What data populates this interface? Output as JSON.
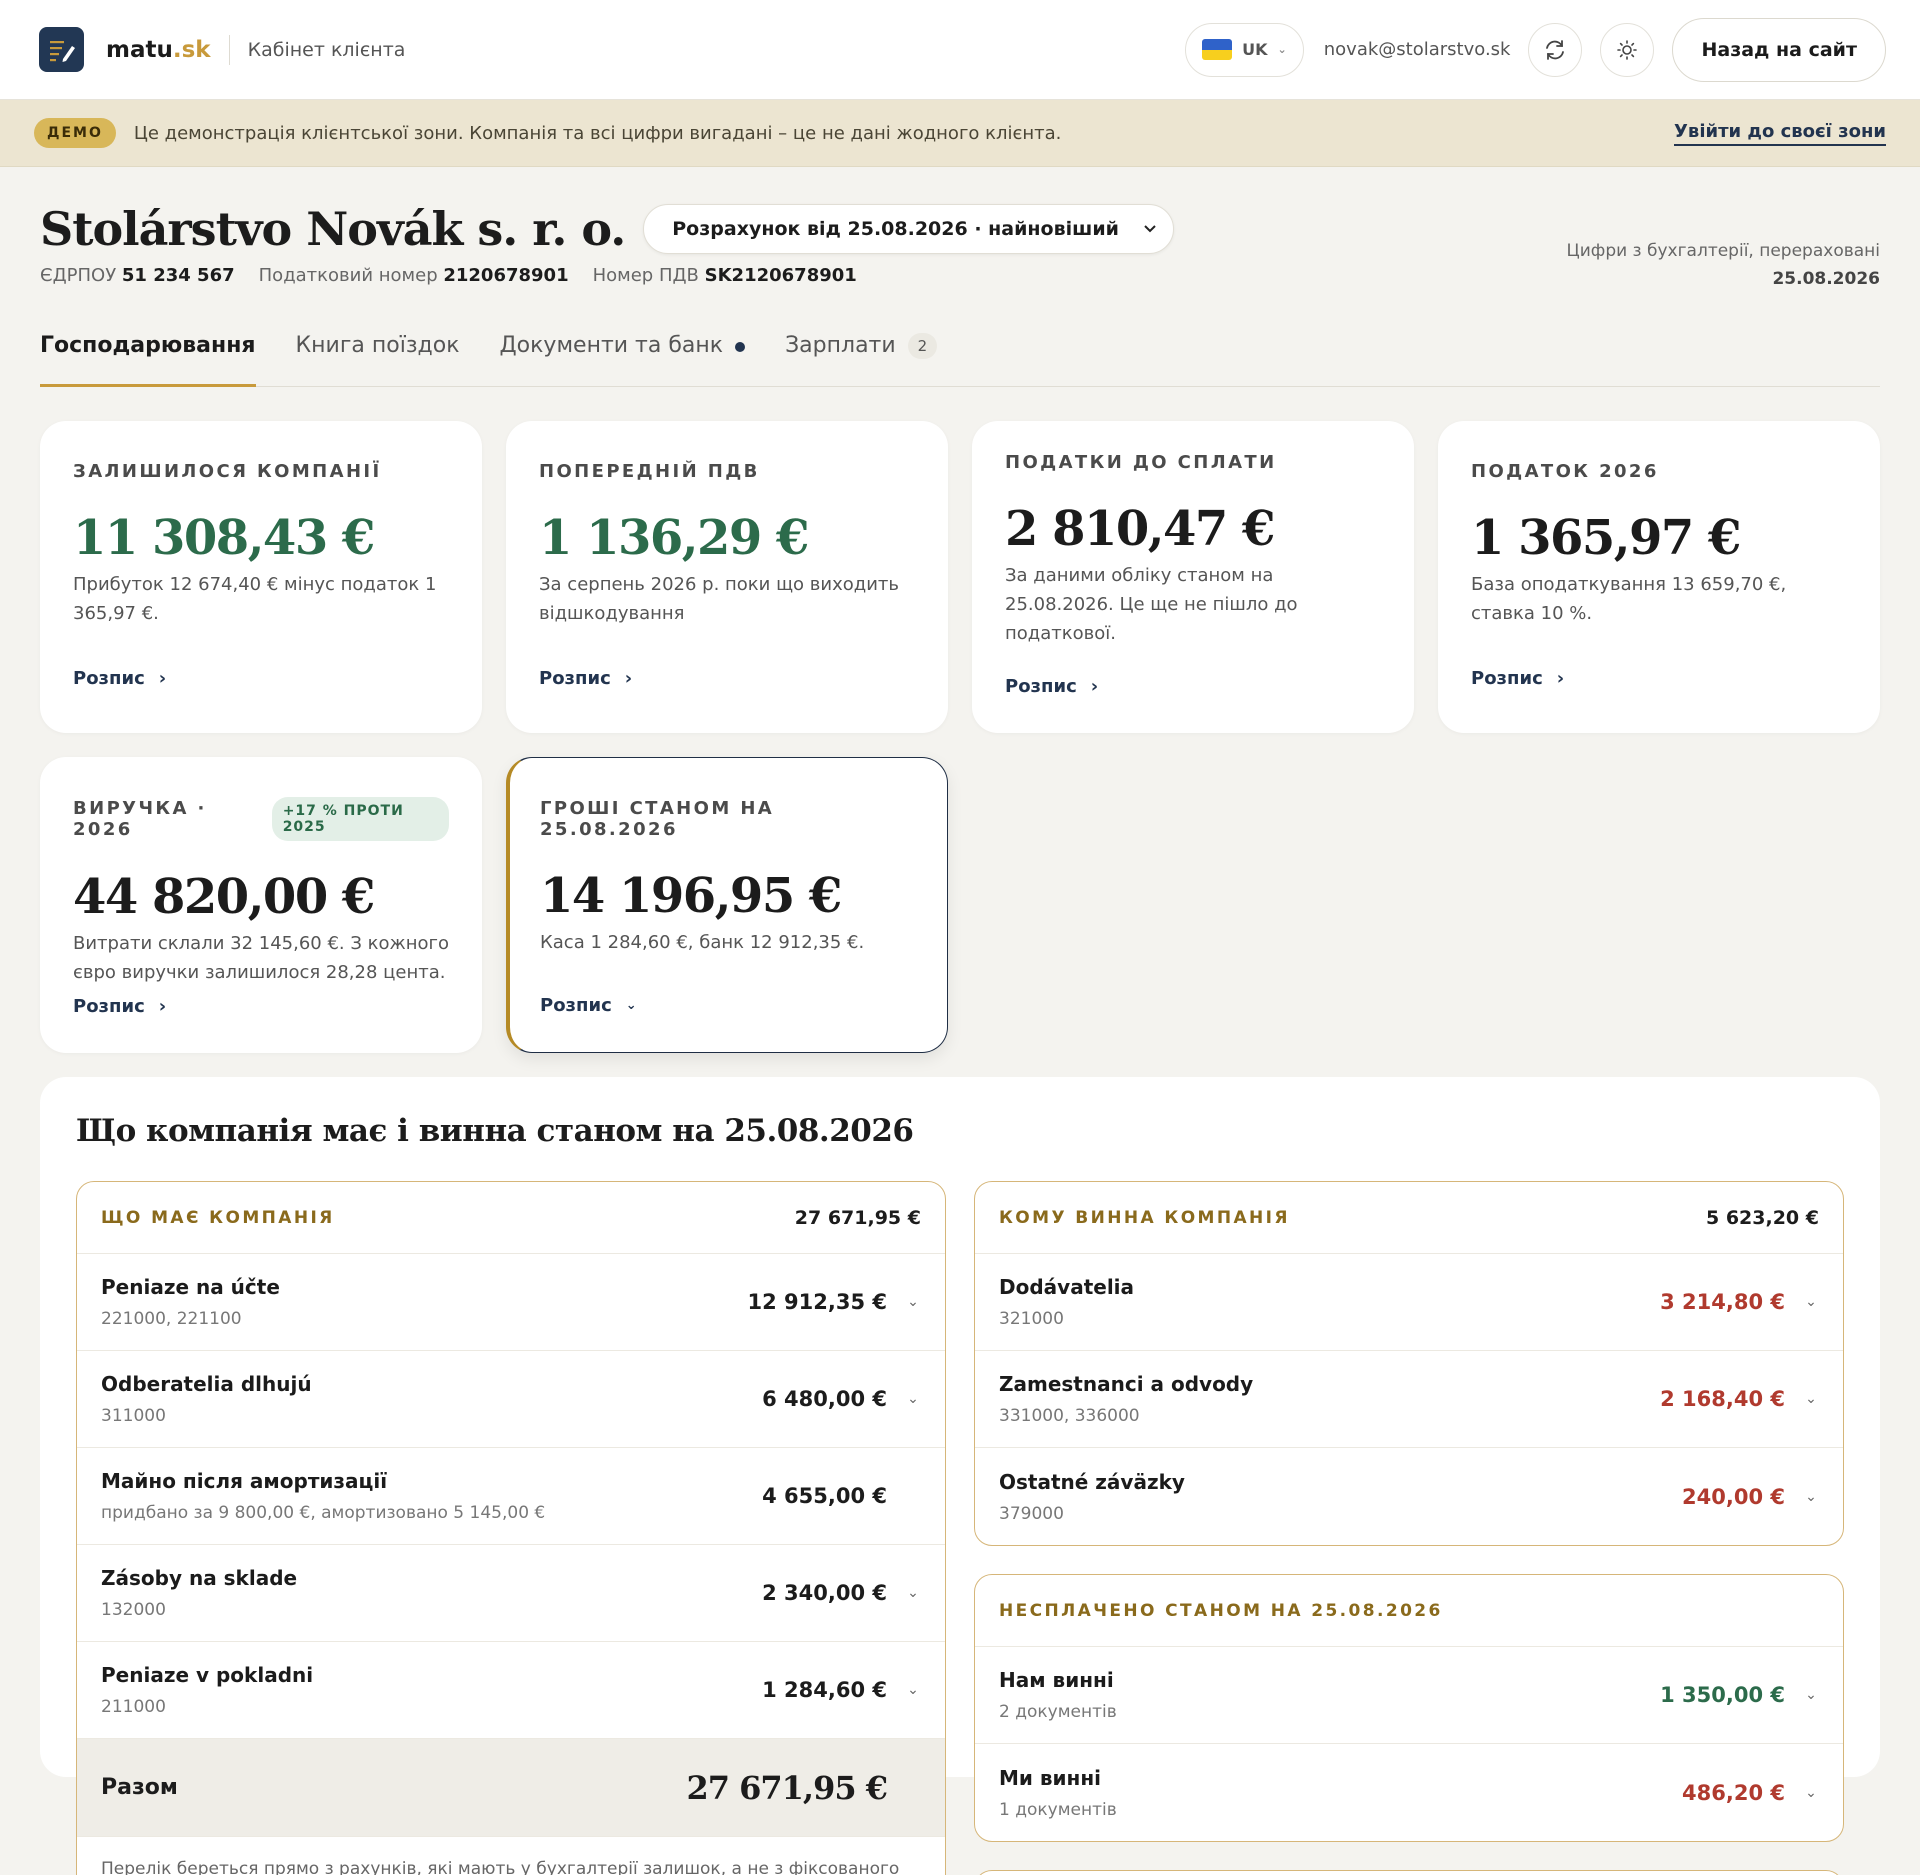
{
  "topbar": {
    "brand_main": "matu",
    "brand_tld": ".sk",
    "cabinet": "Кабінет клієнта",
    "lang": "UK",
    "email": "novak@stolarstvo.sk",
    "back_label": "Назад на сайт"
  },
  "demo": {
    "badge": "ДЕМО",
    "text": "Це демонстрація клієнтської зони. Компанія та всі цифри вигадані – це не дані жодного клієнта.",
    "link": "Увійти до своєї зони"
  },
  "company": {
    "name": "Stolárstvo Novák s. r. o.",
    "calc_select": "Розрахунок від 25.08.2026 · найновіший",
    "ids": [
      {
        "label": "ЄДРПОУ",
        "value": "51 234 567"
      },
      {
        "label": "Податковий номер",
        "value": "2120678901"
      },
      {
        "label": "Номер ПДВ",
        "value": "SK2120678901"
      }
    ],
    "freshness_line1": "Цифри з бухгалтерії, перераховані",
    "freshness_line2": "25.08.2026"
  },
  "tabs": [
    {
      "label": "Господарювання"
    },
    {
      "label": "Книга поїздок"
    },
    {
      "label": "Документи та банк"
    },
    {
      "label": "Зарплати",
      "count": "2"
    }
  ],
  "cards": [
    {
      "label": "ЗАЛИШИЛОСЯ КОМПАНІЇ",
      "value": "11 308,43 €",
      "desc": "Прибуток 12 674,40 € мінус податок 1 365,97 €.",
      "link": "Розпис"
    },
    {
      "label": "ПОПЕРЕДНІЙ ПДВ",
      "value": "1 136,29 €",
      "desc": "За серпень 2026 р. поки що виходить відшкодування",
      "link": "Розпис"
    },
    {
      "label": "ПОДАТКИ ДО СПЛАТИ",
      "value": "2 810,47 €",
      "desc": "За даними обліку станом на 25.08.2026. Це ще не пішло до податкової.",
      "link": "Розпис"
    },
    {
      "label": "ПОДАТОК 2026",
      "value": "1 365,97 €",
      "desc": "База оподаткування 13 659,70 €, ставка 10 %.",
      "link": "Розпис"
    },
    {
      "label": "ВИРУЧКА · 2026",
      "pill": "+17 % ПРОТИ 2025",
      "value": "44 820,00 €",
      "desc": "Витрати склали 32 145,60 €. З кожного євро виручки залишилося 28,28 цента.",
      "link": "Розпис"
    },
    {
      "label": "ГРОШІ СТАНОМ НА 25.08.2026",
      "value": "14 196,95 €",
      "desc": "Каса 1 284,60 €, банк 12 912,35 €.",
      "link": "Розпис"
    }
  ],
  "balance": {
    "title": "Що компанія має і винна станом на 25.08.2026",
    "assets": {
      "label": "ЩО МАЄ КОМПАНІЯ",
      "total": "27 671,95 €",
      "rows": [
        {
          "name": "Peniaze na účte",
          "sub": "221000, 221100",
          "amount": "12 912,35 €"
        },
        {
          "name": "Odberatelia dlhujú",
          "sub": "311000",
          "amount": "6 480,00 €"
        },
        {
          "name": "Майно після амортизації",
          "sub": "придбано за 9 800,00 €, амортизовано 5 145,00 €",
          "amount": "4 655,00 €"
        },
        {
          "name": "Zásoby na sklade",
          "sub": "132000",
          "amount": "2 340,00 €"
        },
        {
          "name": "Peniaze v pokladni",
          "sub": "211000",
          "amount": "1 284,60 €"
        }
      ],
      "sum_label": "Разом",
      "sum_value": "27 671,95 €",
      "note": "Перелік береться прямо з рахунків, які мають у бухгалтерії залишок, а не з фіксованого"
    },
    "liabilities": {
      "label": "КОМУ ВИННА КОМПАНІЯ",
      "total": "5 623,20 €",
      "rows": [
        {
          "name": "Dodávatelia",
          "sub": "321000",
          "amount": "3 214,80 €"
        },
        {
          "name": "Zamestnanci a odvody",
          "sub": "331000, 336000",
          "amount": "2 168,40 €"
        },
        {
          "name": "Ostatné záväzky",
          "sub": "379000",
          "amount": "240,00 €"
        }
      ]
    },
    "unpaid": {
      "label": "НЕСПЛАЧЕНО СТАНОМ НА 25.08.2026",
      "rows": [
        {
          "name": "Нам винні",
          "sub": "2 документів",
          "amount": "1 350,00 €"
        },
        {
          "name": "Ми винні",
          "sub": "1 документів",
          "amount": "486,20 €"
        }
      ]
    }
  },
  "colors": {
    "accent": "#c89a3b",
    "navy": "#22344f",
    "positive": "#2c6b4b",
    "negative": "#b03a2e",
    "background": "#f4f3ef"
  }
}
